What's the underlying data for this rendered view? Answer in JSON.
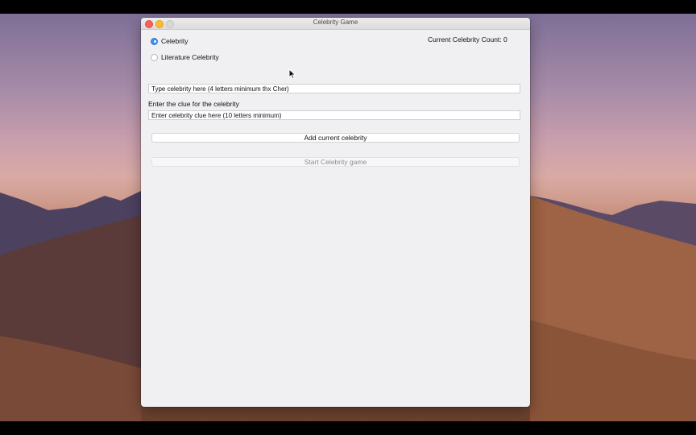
{
  "window": {
    "title": "Celebrity Game"
  },
  "radio_options": [
    {
      "label": "Celebrity",
      "selected": true
    },
    {
      "label": "Literature Celebrity",
      "selected": false
    }
  ],
  "status": {
    "count_text": "Current Celebrity Count: 0"
  },
  "celebrity_input": {
    "value": "Type celebrity here (4 letters minimum thx Cher)"
  },
  "clue_label": "Enter the clue for the celebrity",
  "clue_input": {
    "value": "Enter celebrity clue here (10 letters minimum)"
  },
  "buttons": {
    "add_label": "Add current celebrity",
    "start_label": "Start Celebrity game",
    "start_enabled": false
  },
  "colors": {
    "accent": "#3b8ef1",
    "close": "#fc5f57",
    "minimize": "#fdbc2e"
  }
}
